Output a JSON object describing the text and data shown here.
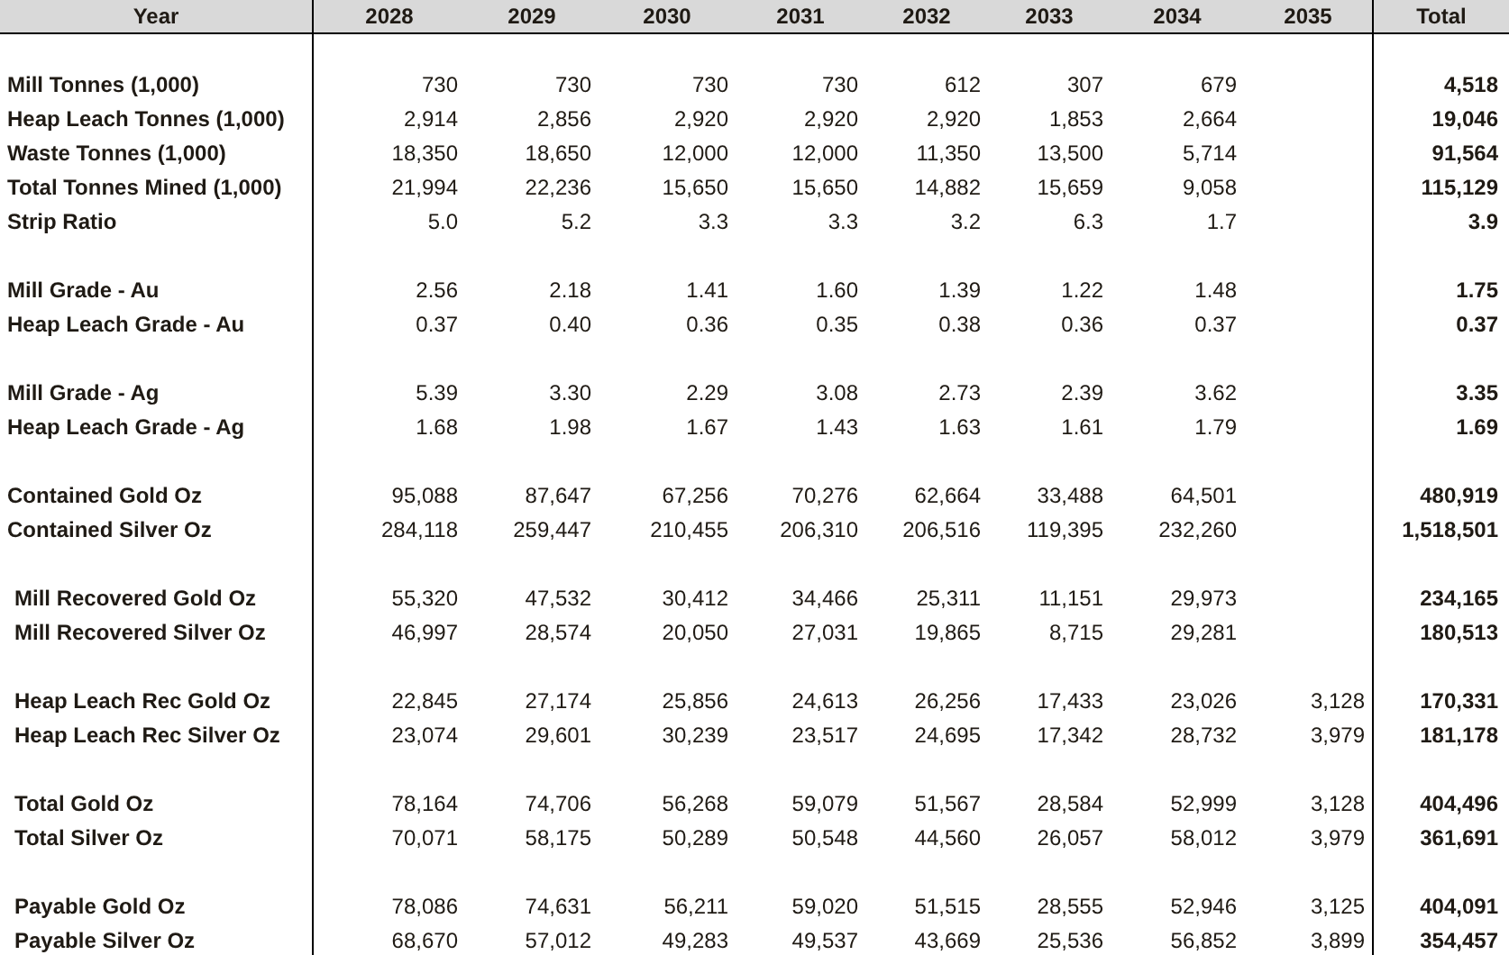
{
  "table": {
    "columns": [
      "Year",
      "2028",
      "2029",
      "2030",
      "2031",
      "2032",
      "2033",
      "2034",
      "2035",
      "Total"
    ],
    "sections": [
      {
        "rows": [
          {
            "label": "Mill Tonnes (1,000)",
            "indented": false,
            "values": [
              "730",
              "730",
              "730",
              "730",
              "612",
              "307",
              "679"
            ],
            "total": "4,518"
          },
          {
            "label": "Heap Leach Tonnes (1,000)",
            "indented": false,
            "values": [
              "2,914",
              "2,856",
              "2,920",
              "2,920",
              "2,920",
              "1,853",
              "2,664"
            ],
            "total": "19,046"
          },
          {
            "label": "Waste Tonnes (1,000)",
            "indented": false,
            "values": [
              "18,350",
              "18,650",
              "12,000",
              "12,000",
              "11,350",
              "13,500",
              "5,714"
            ],
            "total": "91,564"
          },
          {
            "label": "Total Tonnes Mined (1,000)",
            "indented": false,
            "values": [
              "21,994",
              "22,236",
              "15,650",
              "15,650",
              "14,882",
              "15,659",
              "9,058"
            ],
            "total": "115,129"
          },
          {
            "label": "Strip Ratio",
            "indented": false,
            "values": [
              "5.0",
              "5.2",
              "3.3",
              "3.3",
              "3.2",
              "6.3",
              "1.7"
            ],
            "total": "3.9"
          }
        ]
      },
      {
        "rows": [
          {
            "label": "Mill Grade - Au",
            "indented": false,
            "values": [
              "2.56",
              "2.18",
              "1.41",
              "1.60",
              "1.39",
              "1.22",
              "1.48"
            ],
            "total": "1.75"
          },
          {
            "label": "Heap Leach Grade - Au",
            "indented": false,
            "values": [
              "0.37",
              "0.40",
              "0.36",
              "0.35",
              "0.38",
              "0.36",
              "0.37"
            ],
            "total": "0.37"
          }
        ]
      },
      {
        "rows": [
          {
            "label": "Mill Grade - Ag",
            "indented": false,
            "values": [
              "5.39",
              "3.30",
              "2.29",
              "3.08",
              "2.73",
              "2.39",
              "3.62"
            ],
            "total": "3.35"
          },
          {
            "label": "Heap Leach Grade - Ag",
            "indented": false,
            "values": [
              "1.68",
              "1.98",
              "1.67",
              "1.43",
              "1.63",
              "1.61",
              "1.79"
            ],
            "total": "1.69"
          }
        ]
      },
      {
        "rows": [
          {
            "label": "Contained Gold Oz",
            "indented": false,
            "values": [
              "95,088",
              "87,647",
              "67,256",
              "70,276",
              "62,664",
              "33,488",
              "64,501"
            ],
            "total": "480,919"
          },
          {
            "label": "Contained Silver Oz",
            "indented": false,
            "values": [
              "284,118",
              "259,447",
              "210,455",
              "206,310",
              "206,516",
              "119,395",
              "232,260"
            ],
            "total": "1,518,501"
          }
        ]
      },
      {
        "rows": [
          {
            "label": "Mill Recovered Gold Oz",
            "indented": true,
            "values": [
              "55,320",
              "47,532",
              "30,412",
              "34,466",
              "25,311",
              "11,151",
              "29,973"
            ],
            "total": "234,165"
          },
          {
            "label": "Mill Recovered Silver Oz",
            "indented": true,
            "values": [
              "46,997",
              "28,574",
              "20,050",
              "27,031",
              "19,865",
              "8,715",
              "29,281"
            ],
            "total": "180,513"
          }
        ]
      },
      {
        "rows": [
          {
            "label": "Heap Leach Rec Gold Oz",
            "indented": true,
            "values": [
              "22,845",
              "27,174",
              "25,856",
              "24,613",
              "26,256",
              "17,433",
              "23,026",
              "3,128"
            ],
            "total": "170,331"
          },
          {
            "label": "Heap Leach Rec Silver Oz",
            "indented": true,
            "values": [
              "23,074",
              "29,601",
              "30,239",
              "23,517",
              "24,695",
              "17,342",
              "28,732",
              "3,979"
            ],
            "total": "181,178"
          }
        ]
      },
      {
        "rows": [
          {
            "label": "Total Gold Oz",
            "indented": true,
            "values": [
              "78,164",
              "74,706",
              "56,268",
              "59,079",
              "51,567",
              "28,584",
              "52,999",
              "3,128"
            ],
            "total": "404,496"
          },
          {
            "label": "Total Silver Oz",
            "indented": true,
            "values": [
              "70,071",
              "58,175",
              "50,289",
              "50,548",
              "44,560",
              "26,057",
              "58,012",
              "3,979"
            ],
            "total": "361,691"
          }
        ]
      },
      {
        "rows": [
          {
            "label": "Payable Gold Oz",
            "indented": true,
            "values": [
              "78,086",
              "74,631",
              "56,211",
              "59,020",
              "51,515",
              "28,555",
              "52,946",
              "3,125"
            ],
            "total": "404,091"
          },
          {
            "label": "Payable Silver Oz",
            "indented": true,
            "values": [
              "68,670",
              "57,012",
              "49,283",
              "49,537",
              "43,669",
              "25,536",
              "56,852",
              "3,899"
            ],
            "total": "354,457"
          }
        ]
      }
    ]
  }
}
